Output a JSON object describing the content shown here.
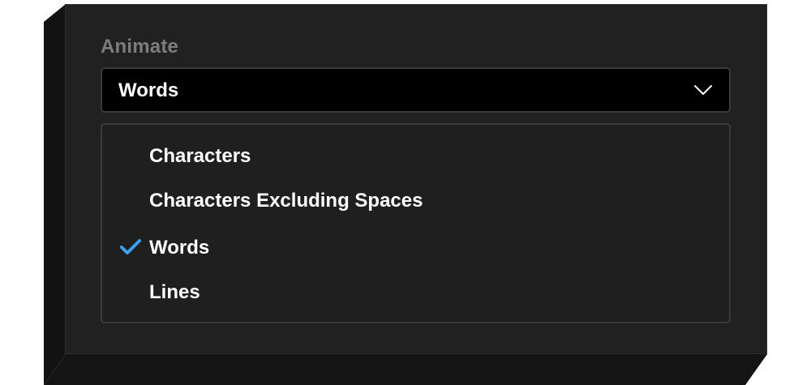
{
  "animate": {
    "label": "Animate",
    "selected_value": "Words",
    "chevron_icon": "chevron-down-icon",
    "options": [
      {
        "label": "Characters",
        "checked": false
      },
      {
        "label": "Characters Excluding Spaces",
        "checked": false
      },
      {
        "label": "Words",
        "checked": true
      },
      {
        "label": "Lines",
        "checked": false
      }
    ],
    "check_icon": "checkmark-icon"
  },
  "colors": {
    "panel": "#212121",
    "select_background": "#000000",
    "border": "#3a3a3a",
    "label": "#7d7d7d",
    "text": "#ffffff",
    "checkmark": "#3f9ff0"
  }
}
